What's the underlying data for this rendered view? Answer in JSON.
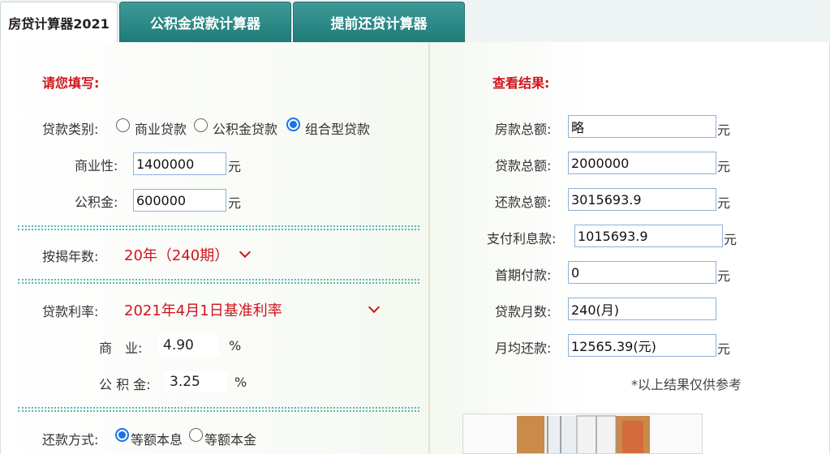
{
  "tabs": [
    {
      "label": "房贷计算器2021"
    },
    {
      "label": "公积金贷款计算器"
    },
    {
      "label": "提前还贷计算器"
    }
  ],
  "form": {
    "heading": "请您填写:",
    "loan_type_label": "贷款类别:",
    "loan_types": [
      "商业贷款",
      "公积金贷款",
      "组合型贷款"
    ],
    "loan_type_selected": "组合型贷款",
    "commercial_label": "商业性:",
    "commercial_value": "1400000",
    "fund_label": "公积金:",
    "fund_value": "600000",
    "unit_yuan": "元",
    "years_label": "按揭年数:",
    "years_value": "20年（240期）",
    "rate_label": "贷款利率:",
    "rate_value": "2021年4月1日基准利率",
    "rate_commercial_label": "商　业:",
    "rate_commercial_value": "4.90",
    "rate_fund_label": "公 积 金:",
    "rate_fund_value": "3.25",
    "percent": "%",
    "repay_label": "还款方式:",
    "repay_options": [
      "等额本息",
      "等额本金"
    ],
    "repay_selected": "等额本息"
  },
  "results": {
    "heading": "查看结果:",
    "house_total_label": "房款总额:",
    "house_total_value": "略",
    "loan_total_label": "贷款总额:",
    "loan_total_value": "2000000",
    "repay_total_label": "还款总额:",
    "repay_total_value": "3015693.9",
    "interest_label": "支付利息款:",
    "interest_value": "1015693.9",
    "down_payment_label": "首期付款:",
    "down_payment_value": "0",
    "months_label": "贷款月数:",
    "months_value": "240(月)",
    "monthly_label": "月均还款:",
    "monthly_value": "12565.39(元)",
    "unit_yuan": "元",
    "note": "*以上结果仅供参考"
  },
  "colors": {
    "accent_red": "#d0141b",
    "tab_teal": "#2a8a87",
    "radio_blue": "#1a73e8"
  }
}
